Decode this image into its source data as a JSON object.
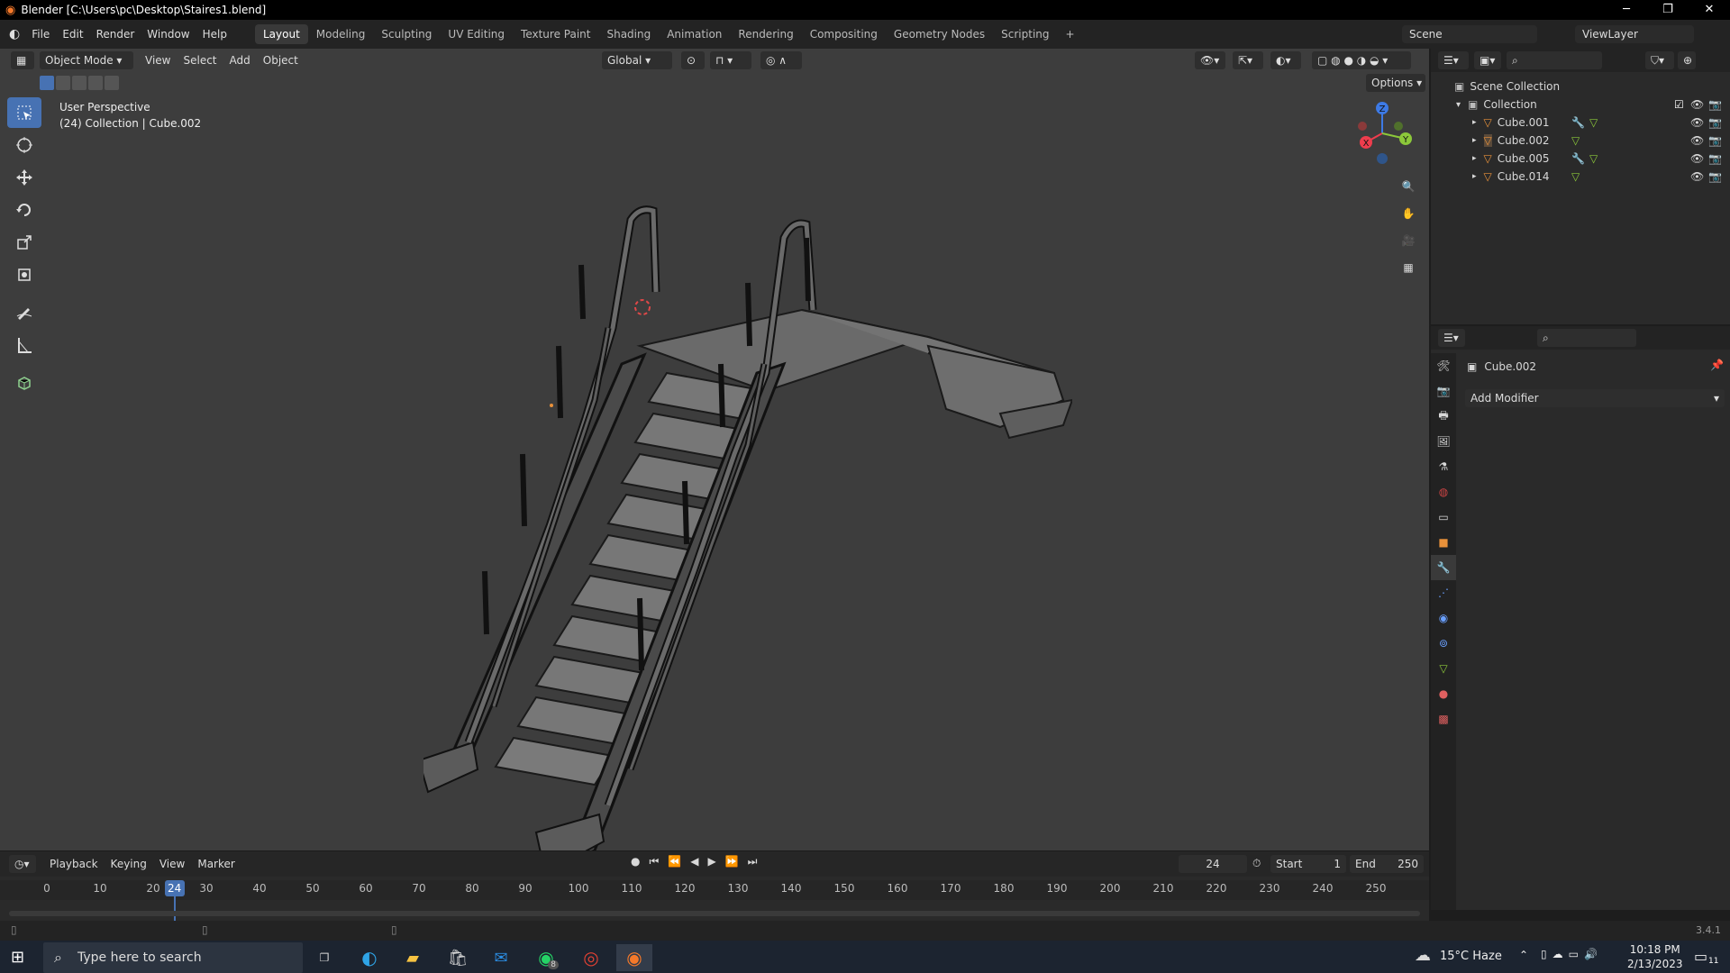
{
  "window": {
    "title": "Blender [C:\\Users\\pc\\Desktop\\Staires1.blend]",
    "minimize": "─",
    "restore": "❐",
    "close": "✕"
  },
  "menu": [
    "File",
    "Edit",
    "Render",
    "Window",
    "Help"
  ],
  "workspaces": [
    "Layout",
    "Modeling",
    "Sculpting",
    "UV Editing",
    "Texture Paint",
    "Shading",
    "Animation",
    "Rendering",
    "Compositing",
    "Geometry Nodes",
    "Scripting",
    "+"
  ],
  "active_workspace": "Layout",
  "scene": "Scene",
  "view_layer": "ViewLayer",
  "viewport": {
    "mode": "Object Mode",
    "menus": [
      "View",
      "Select",
      "Add",
      "Object"
    ],
    "orientation": "Global",
    "options": "Options",
    "perspective": "User Perspective",
    "collection_info": "(24) Collection | Cube.002",
    "gizmo": {
      "x": "X",
      "y": "Y",
      "z": "Z"
    }
  },
  "timeline": {
    "menus": [
      "Playback",
      "Keying",
      "View",
      "Marker"
    ],
    "current_frame": "24",
    "start_label": "Start",
    "start": "1",
    "end_label": "End",
    "end": "250",
    "ruler": [
      "0",
      "10",
      "20",
      "30",
      "40",
      "50",
      "60",
      "70",
      "80",
      "90",
      "100",
      "110",
      "120",
      "130",
      "140",
      "150",
      "160",
      "170",
      "180",
      "190",
      "200",
      "210",
      "220",
      "230",
      "240",
      "250"
    ]
  },
  "outliner": {
    "scene_collection": "Scene Collection",
    "collection": "Collection",
    "objects": [
      {
        "name": "Cube.001"
      },
      {
        "name": "Cube.002"
      },
      {
        "name": "Cube.005"
      },
      {
        "name": "Cube.014"
      }
    ]
  },
  "properties": {
    "object_name": "Cube.002",
    "add_modifier": "Add Modifier"
  },
  "version": "3.4.1",
  "taskbar": {
    "search_placeholder": "Type here to search",
    "weather": "15°C  Haze",
    "time": "10:18 PM",
    "date": "2/13/2023",
    "whatsapp_badge": "8",
    "notif_badge": "11"
  },
  "colors": {
    "accent": "#4772b3",
    "x_axis": "#ee3d4d",
    "y_axis": "#8cc83a",
    "z_axis": "#3d7ae5",
    "orange": "#e8913a"
  }
}
